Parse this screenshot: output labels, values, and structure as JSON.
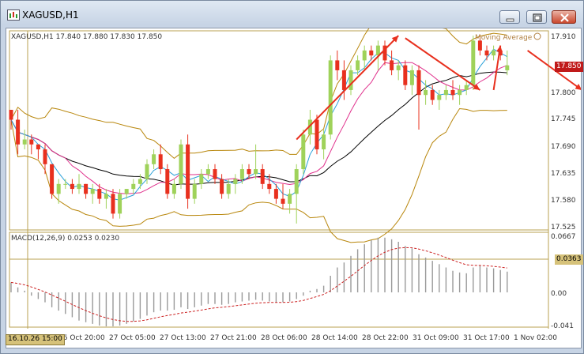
{
  "window": {
    "title": "XAGUSD,H1"
  },
  "header": {
    "symbol_info": "XAGUSD,H1  17.840 17.880 17.830 17.850",
    "indicator_name": "Moving Average"
  },
  "price_axis": {
    "labels": [
      "17.910",
      "17.850",
      "17.800",
      "17.745",
      "17.690",
      "17.635",
      "17.580",
      "17.525"
    ],
    "current_price": "17.850"
  },
  "macd": {
    "label": "MACD(12,26,9) 0.0253 0.0230",
    "axis_labels": [
      "0.0667",
      "0.0363",
      "0.00",
      "-0.041"
    ]
  },
  "time_axis": {
    "labels": [
      "26 Oct 20:00",
      "27 Oct 05:00",
      "27 Oct 13:00",
      "27 Oct 21:00",
      "28 Oct 06:00",
      "28 Oct 14:00",
      "28 Oct 22:00",
      "31 Oct 09:00",
      "31 Oct 17:00",
      "1 Nov 02:00"
    ],
    "cursor_label": "16.10.26 15:00"
  },
  "colors": {
    "bull": "#9fd25a",
    "bear": "#e8301e",
    "bands": "#b8860b",
    "ma_black": "#000000",
    "ma_magenta": "#e0308c",
    "ma_cyan": "#2aa0d8",
    "signal": "#cc2222",
    "arrow": "#e8301e"
  },
  "chart_data": {
    "type": "candlestick",
    "symbol": "XAGUSD",
    "timeframe": "H1",
    "ylim": [
      17.525,
      17.915
    ],
    "candles": [
      [
        17.76,
        17.76,
        17.72,
        17.74
      ],
      [
        17.74,
        17.76,
        17.67,
        17.69
      ],
      [
        17.69,
        17.72,
        17.68,
        17.7
      ],
      [
        17.7,
        17.71,
        17.67,
        17.69
      ],
      [
        17.69,
        17.69,
        17.66,
        17.68
      ],
      [
        17.68,
        17.69,
        17.63,
        17.65
      ],
      [
        17.65,
        17.65,
        17.58,
        17.59
      ],
      [
        17.59,
        17.62,
        17.57,
        17.61
      ],
      [
        17.61,
        17.62,
        17.6,
        17.61
      ],
      [
        17.61,
        17.62,
        17.59,
        17.6
      ],
      [
        17.6,
        17.63,
        17.59,
        17.61
      ],
      [
        17.61,
        17.61,
        17.58,
        17.59
      ],
      [
        17.59,
        17.61,
        17.57,
        17.6
      ],
      [
        17.6,
        17.61,
        17.57,
        17.58
      ],
      [
        17.58,
        17.6,
        17.56,
        17.59
      ],
      [
        17.59,
        17.6,
        17.54,
        17.55
      ],
      [
        17.55,
        17.6,
        17.54,
        17.59
      ],
      [
        17.59,
        17.6,
        17.58,
        17.6
      ],
      [
        17.6,
        17.62,
        17.59,
        17.61
      ],
      [
        17.61,
        17.63,
        17.6,
        17.62
      ],
      [
        17.62,
        17.66,
        17.61,
        17.65
      ],
      [
        17.65,
        17.68,
        17.64,
        17.67
      ],
      [
        17.67,
        17.69,
        17.63,
        17.64
      ],
      [
        17.64,
        17.65,
        17.58,
        17.59
      ],
      [
        17.59,
        17.62,
        17.58,
        17.61
      ],
      [
        17.61,
        17.7,
        17.6,
        17.69
      ],
      [
        17.69,
        17.71,
        17.56,
        17.58
      ],
      [
        17.58,
        17.62,
        17.57,
        17.61
      ],
      [
        17.61,
        17.64,
        17.6,
        17.63
      ],
      [
        17.63,
        17.65,
        17.62,
        17.64
      ],
      [
        17.64,
        17.65,
        17.61,
        17.62
      ],
      [
        17.62,
        17.63,
        17.58,
        17.59
      ],
      [
        17.59,
        17.62,
        17.58,
        17.61
      ],
      [
        17.61,
        17.63,
        17.59,
        17.62
      ],
      [
        17.62,
        17.65,
        17.61,
        17.64
      ],
      [
        17.64,
        17.65,
        17.62,
        17.63
      ],
      [
        17.63,
        17.69,
        17.62,
        17.64
      ],
      [
        17.64,
        17.65,
        17.6,
        17.61
      ],
      [
        17.61,
        17.63,
        17.59,
        17.6
      ],
      [
        17.6,
        17.61,
        17.57,
        17.58
      ],
      [
        17.58,
        17.61,
        17.56,
        17.57
      ],
      [
        17.57,
        17.6,
        17.55,
        17.59
      ],
      [
        17.59,
        17.65,
        17.53,
        17.64
      ],
      [
        17.64,
        17.72,
        17.63,
        17.71
      ],
      [
        17.71,
        17.76,
        17.69,
        17.74
      ],
      [
        17.74,
        17.75,
        17.67,
        17.68
      ],
      [
        17.68,
        17.72,
        17.66,
        17.71
      ],
      [
        17.71,
        17.87,
        17.7,
        17.86
      ],
      [
        17.86,
        17.88,
        17.82,
        17.84
      ],
      [
        17.84,
        17.86,
        17.78,
        17.8
      ],
      [
        17.8,
        17.85,
        17.79,
        17.84
      ],
      [
        17.84,
        17.87,
        17.83,
        17.86
      ],
      [
        17.86,
        17.89,
        17.84,
        17.88
      ],
      [
        17.88,
        17.89,
        17.86,
        17.87
      ],
      [
        17.87,
        17.9,
        17.84,
        17.89
      ],
      [
        17.89,
        17.9,
        17.85,
        17.86
      ],
      [
        17.86,
        17.88,
        17.83,
        17.84
      ],
      [
        17.84,
        17.86,
        17.82,
        17.85
      ],
      [
        17.85,
        17.86,
        17.8,
        17.81
      ],
      [
        17.81,
        17.85,
        17.79,
        17.84
      ],
      [
        17.84,
        17.85,
        17.72,
        17.79
      ],
      [
        17.79,
        17.82,
        17.77,
        17.8
      ],
      [
        17.8,
        17.81,
        17.77,
        17.78
      ],
      [
        17.78,
        17.8,
        17.76,
        17.79
      ],
      [
        17.79,
        17.81,
        17.78,
        17.8
      ],
      [
        17.8,
        17.82,
        17.78,
        17.79
      ],
      [
        17.79,
        17.81,
        17.77,
        17.8
      ],
      [
        17.8,
        17.82,
        17.79,
        17.81
      ],
      [
        17.81,
        17.91,
        17.8,
        17.9
      ],
      [
        17.9,
        17.91,
        17.87,
        17.88
      ],
      [
        17.88,
        17.89,
        17.86,
        17.87
      ],
      [
        17.87,
        17.89,
        17.86,
        17.88
      ],
      [
        17.88,
        17.89,
        17.86,
        17.87
      ],
      [
        17.84,
        17.88,
        17.83,
        17.85
      ]
    ],
    "macd_hist": [
      0.012,
      0.006,
      0.002,
      -0.004,
      -0.008,
      -0.012,
      -0.018,
      -0.022,
      -0.026,
      -0.03,
      -0.034,
      -0.036,
      -0.038,
      -0.04,
      -0.041,
      -0.041,
      -0.04,
      -0.038,
      -0.035,
      -0.032,
      -0.028,
      -0.024,
      -0.022,
      -0.022,
      -0.021,
      -0.018,
      -0.02,
      -0.018,
      -0.016,
      -0.014,
      -0.014,
      -0.015,
      -0.014,
      -0.012,
      -0.011,
      -0.01,
      -0.009,
      -0.01,
      -0.011,
      -0.012,
      -0.012,
      -0.011,
      -0.008,
      -0.004,
      0.002,
      0.004,
      0.008,
      0.02,
      0.03,
      0.036,
      0.044,
      0.052,
      0.058,
      0.063,
      0.066,
      0.066,
      0.064,
      0.061,
      0.056,
      0.053,
      0.046,
      0.042,
      0.038,
      0.034,
      0.03,
      0.026,
      0.024,
      0.023,
      0.03,
      0.032,
      0.03,
      0.029,
      0.027,
      0.025
    ]
  }
}
